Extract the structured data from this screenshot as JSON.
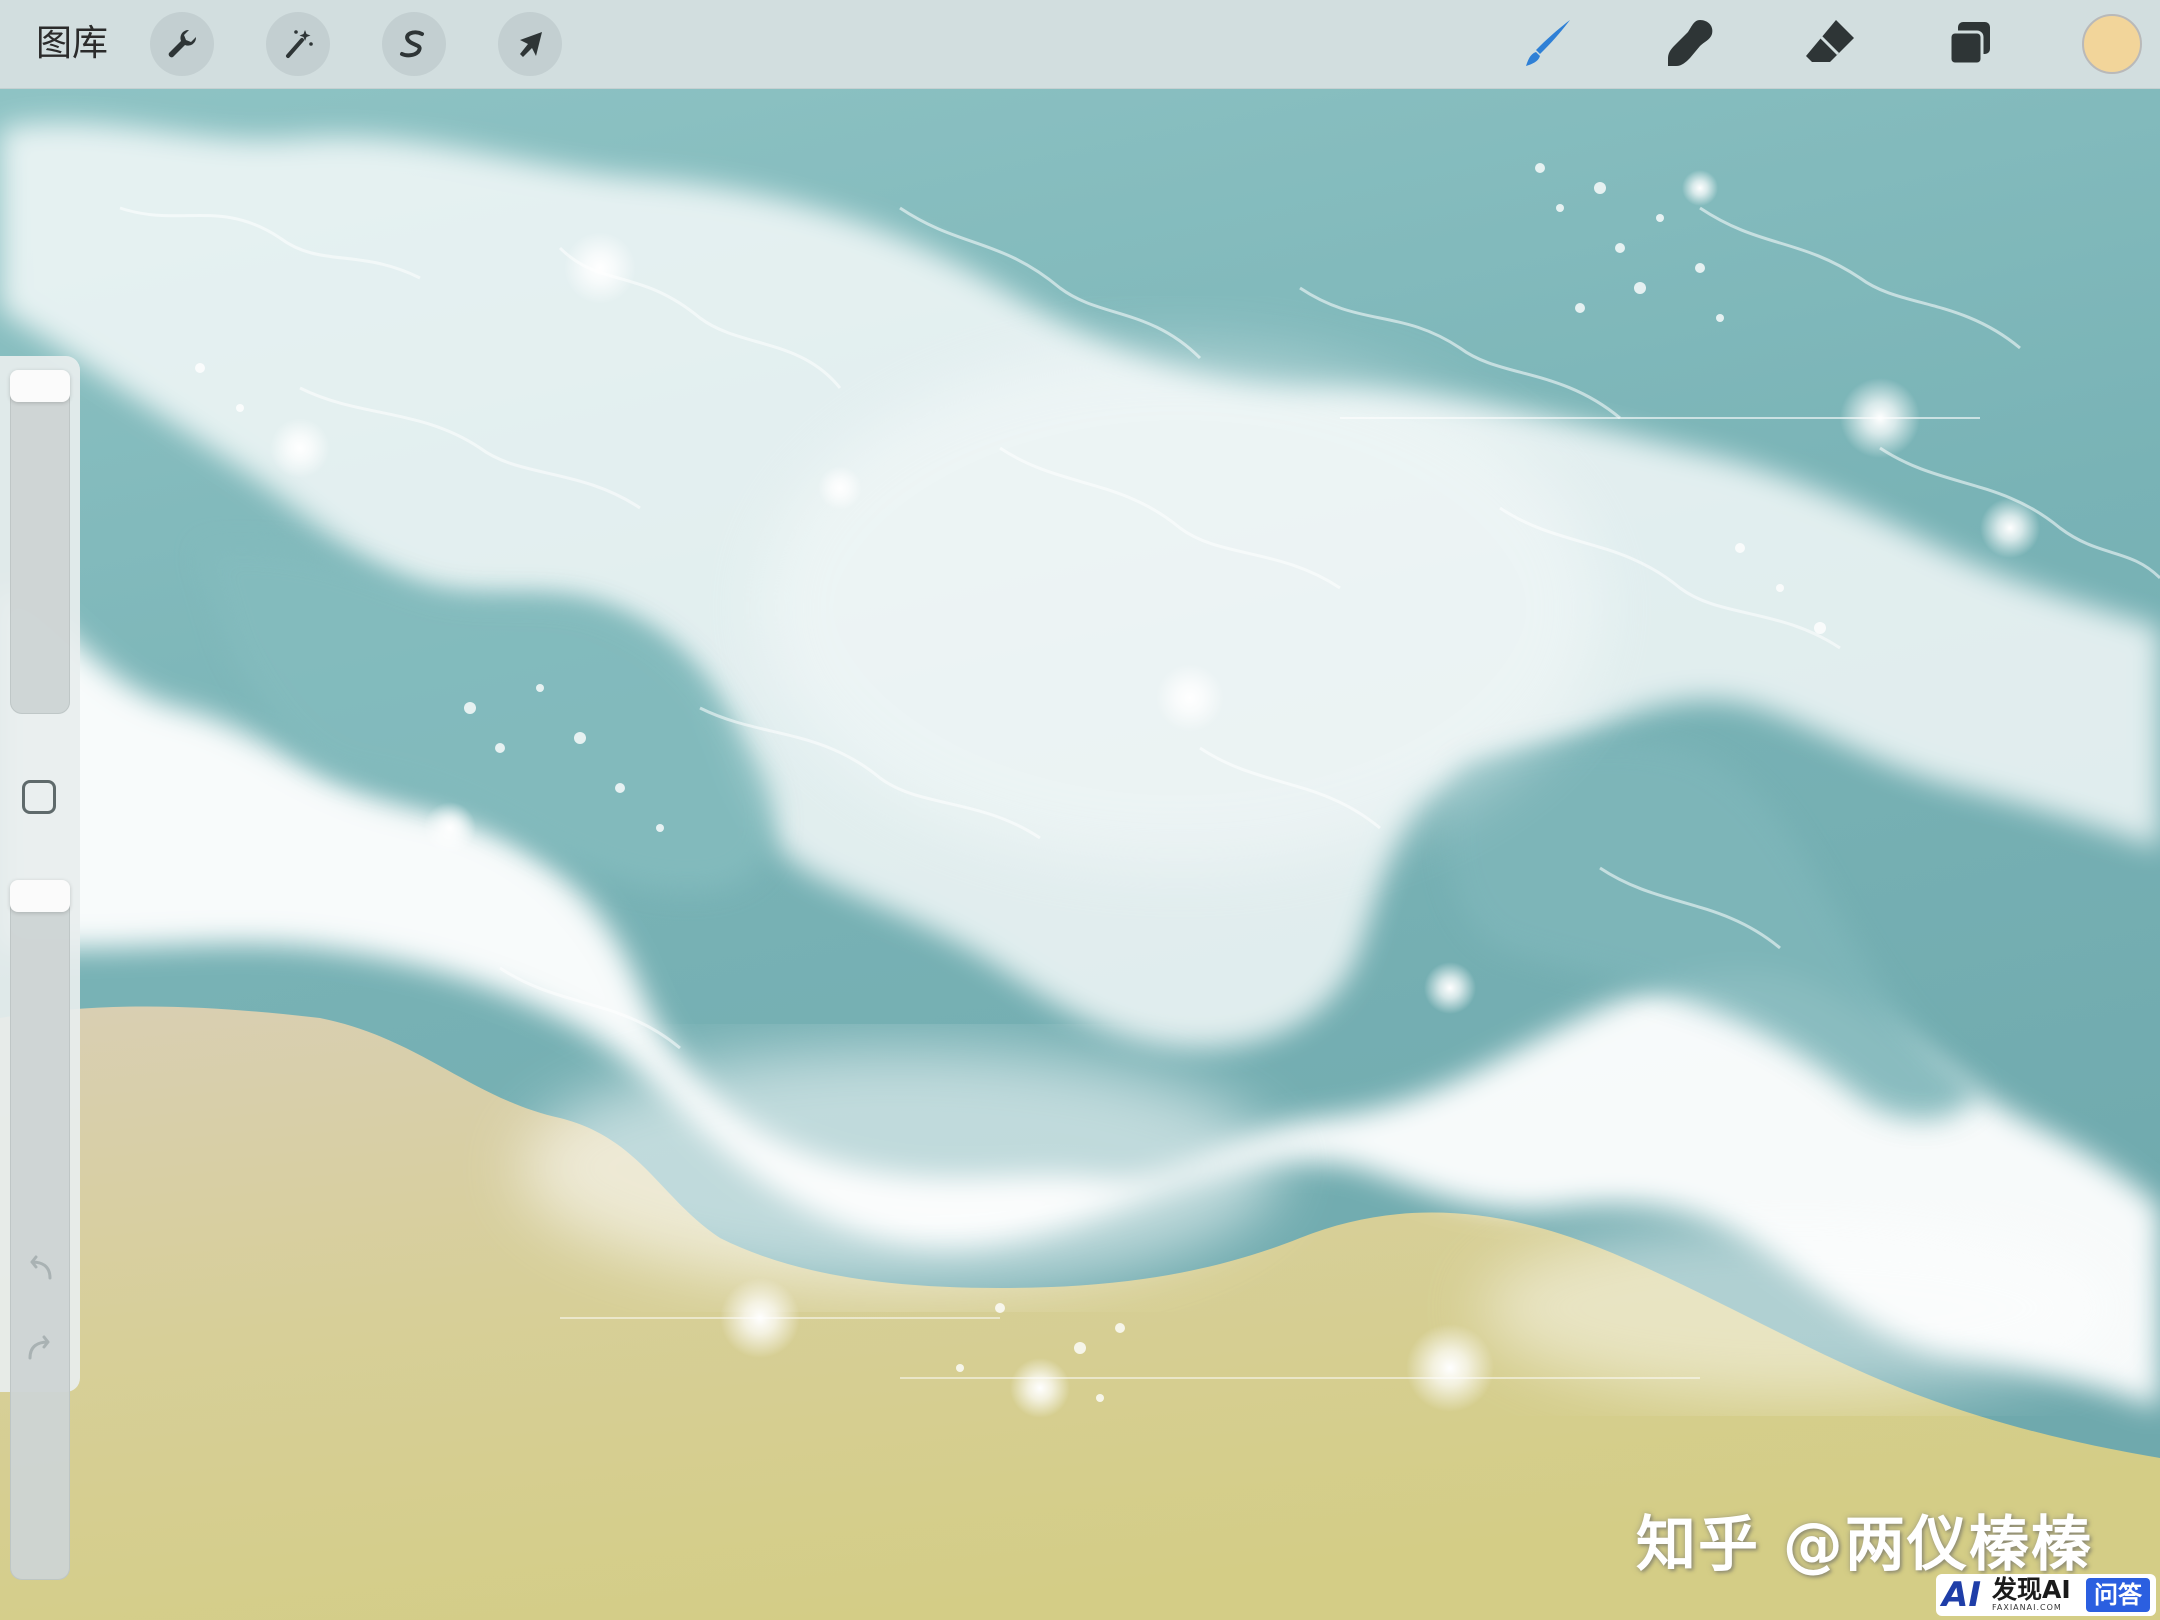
{
  "toolbar": {
    "gallery_label": "图库",
    "left_tools": [
      {
        "name": "actions",
        "icon": "wrench-icon"
      },
      {
        "name": "adjustments",
        "icon": "magic-wand-icon"
      },
      {
        "name": "selection",
        "icon": "selection-s-icon"
      },
      {
        "name": "transform",
        "icon": "arrow-cursor-icon"
      }
    ],
    "right_tools": [
      {
        "name": "brush",
        "icon": "brush-icon",
        "active": true
      },
      {
        "name": "smudge",
        "icon": "smudge-finger-icon"
      },
      {
        "name": "eraser",
        "icon": "eraser-icon"
      },
      {
        "name": "layers",
        "icon": "layers-icon"
      }
    ],
    "current_color": "#f2d59a",
    "active_color": "#2f80d6"
  },
  "sidebar": {
    "brush_size_level": 0.02,
    "opacity_level": 0.02,
    "modify_button": "square-icon",
    "undo_icon": "undo-arrow-icon",
    "redo_icon": "redo-arrow-icon"
  },
  "canvas": {
    "colors": {
      "sea": "#7fb8bb",
      "foam": "#ffffff",
      "sand": "#d6cc8f",
      "wet_sand": "#c9bfa3"
    }
  },
  "watermarks": {
    "zhihu": "知乎 @两仪榛榛",
    "badge_logo": "AI",
    "badge_brand": "发现AI",
    "badge_sub": "FAXIANAI.COM",
    "badge_tag": "问答"
  }
}
